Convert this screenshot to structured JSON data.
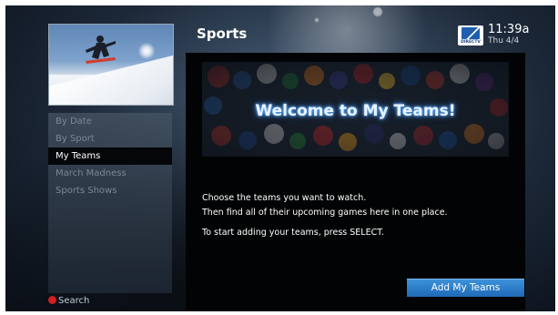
{
  "header": {
    "title": "Sports",
    "logo_text": "DIRECTV",
    "time": "11:39a",
    "date": "Thu 4/4"
  },
  "menu": {
    "items": [
      {
        "label": "By Date",
        "selected": false
      },
      {
        "label": "By Sport",
        "selected": false
      },
      {
        "label": "My Teams",
        "selected": true
      },
      {
        "label": "March Madness",
        "selected": false
      },
      {
        "label": "Sports Shows",
        "selected": false
      }
    ]
  },
  "search": {
    "label": "Search",
    "icon": "red-dot-icon"
  },
  "content": {
    "banner_title": "Welcome to My Teams!",
    "line1": "Choose the teams you want to watch.",
    "line2": "Then find all of their upcoming games here in one place.",
    "line3": "To start adding your teams, press SELECT.",
    "button_label": "Add My Teams"
  },
  "colors": {
    "accent": "#2a7cc7",
    "selected_bg": "#050608",
    "search_dot": "#d21f1f"
  }
}
